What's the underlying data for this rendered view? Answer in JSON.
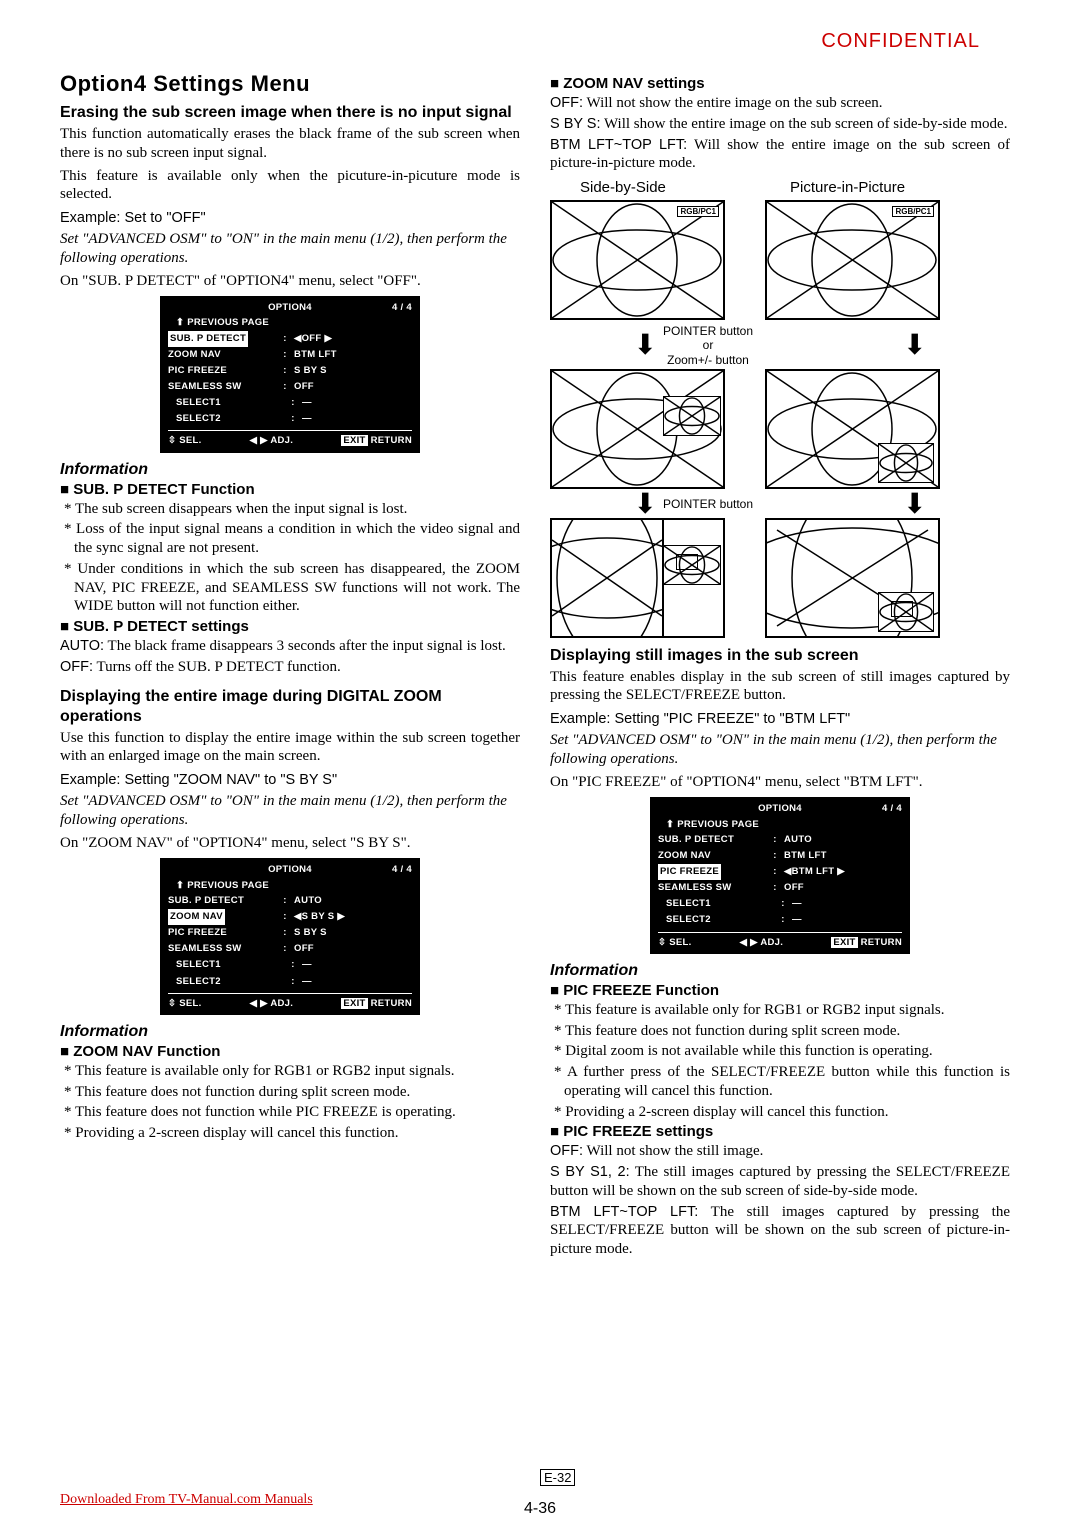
{
  "header": {
    "confidential": "CONFIDENTIAL"
  },
  "left": {
    "main_title": "Option4 Settings Menu",
    "sect1_title": "Erasing the sub screen image when there is no input signal",
    "sect1_p1": "This function automatically erases the black frame of the sub screen when there is no sub screen input signal.",
    "sect1_p2": "This feature is available only when the picuture-in-picuture mode is selected.",
    "sect1_example": "Example: Set to \"OFF\"",
    "sect1_ital": "Set \"ADVANCED OSM\" to \"ON\" in the main menu (1/2), then perform the following operations.",
    "sect1_p3": "On \"SUB. P DETECT\" of \"OPTION4\" menu, select \"OFF\".",
    "info1_title": "Information",
    "info1_h1": "SUB. P DETECT Function",
    "info1_b1": "* The sub screen disappears when the input signal is lost.",
    "info1_b2": "* Loss of the input signal means a condition in which the video signal and the sync signal are not present.",
    "info1_b3": "* Under conditions in which the sub screen has disappeared, the ZOOM NAV, PIC FREEZE, and SEAMLESS SW functions will not work. The WIDE button will not function either.",
    "info1_h2": "SUB. P DETECT settings",
    "info1_set1_label": "AUTO:",
    "info1_set1_body": " The black frame disappears 3 seconds after the input signal is lost.",
    "info1_set2_label": "OFF:",
    "info1_set2_body": " Turns off the SUB. P DETECT function.",
    "sect2_title": "Displaying the entire image during DIGITAL ZOOM operations",
    "sect2_p1": "Use this function to display the entire image within the sub screen together with an enlarged image on the main screen.",
    "sect2_example": "Example: Setting \"ZOOM NAV\" to \"S BY S\"",
    "sect2_ital": "Set \"ADVANCED OSM\" to \"ON\" in the main menu (1/2), then perform the following operations.",
    "sect2_p2": "On \"ZOOM NAV\" of \"OPTION4\" menu, select \"S BY S\".",
    "info2_title": "Information",
    "info2_h1": "ZOOM NAV Function",
    "info2_b1": "* This feature is available only for RGB1 or RGB2 input signals.",
    "info2_b2": "* This feature does not function during split screen mode.",
    "info2_b3": "* This feature does not function while PIC FREEZE is operating.",
    "info2_b4": "* Providing a 2-screen display will cancel this function."
  },
  "right": {
    "zoomnav_h": "ZOOM NAV settings",
    "zn_off_label": "OFF:",
    "zn_off_body": " Will not show the entire image on the sub screen.",
    "zn_sbs_label": "S BY S:",
    "zn_sbs_body": " Will show the entire image on the sub screen of side-by-side mode.",
    "zn_btm_label": "BTM LFT~TOP LFT:",
    "zn_btm_body": " Will show the entire image on the sub screen of picture-in-picture mode.",
    "diag_sbs": "Side-by-Side",
    "diag_pip": "Picture-in-Picture",
    "diag_tag": "RGB/PC1",
    "arrow1_a": "POINTER button",
    "arrow1_b": "or",
    "arrow1_c": "Zoom+/- button",
    "arrow2": "POINTER button",
    "sect3_title": "Displaying still images in the sub screen",
    "sect3_p1": "This feature enables display in the sub screen of still images captured by pressing the SELECT/FREEZE button.",
    "sect3_example": "Example: Setting \"PIC FREEZE\" to \"BTM LFT\"",
    "sect3_ital": "Set \"ADVANCED OSM\" to \"ON\" in the main menu (1/2), then perform the following operations.",
    "sect3_p2": "On \"PIC FREEZE\" of \"OPTION4\" menu, select \"BTM LFT\".",
    "info3_title": "Information",
    "info3_h1": "PIC FREEZE Function",
    "info3_b1": "* This feature is available only for RGB1 or RGB2 input signals.",
    "info3_b2": "* This feature does not function during split screen mode.",
    "info3_b3": "* Digital zoom is not available while this function is operating.",
    "info3_b4": "* A further press of the SELECT/FREEZE button while this function is operating will cancel this function.",
    "info3_b5": "* Providing a 2-screen display will cancel this function.",
    "info3_h2": "PIC FREEZE settings",
    "pf_off_label": "OFF:",
    "pf_off_body": " Will not show the still image.",
    "pf_sbs_label": "S BY S1, 2:",
    "pf_sbs_body": " The still images captured by pressing the SELECT/FREEZE button will be shown on the sub screen of side-by-side mode.",
    "pf_btm_label": "BTM LFT~TOP LFT:",
    "pf_btm_body": " The still images captured by pressing the SELECT/FREEZE button will be shown on the sub screen of picture-in-picture mode."
  },
  "osd": {
    "title": "OPTION4",
    "page": "4 / 4",
    "prev": "⬆ PREVIOUS PAGE",
    "items": {
      "sub_p": "SUB. P DETECT",
      "zoom": "ZOOM NAV",
      "pic": "PIC FREEZE",
      "seam": "SEAMLESS SW",
      "sel1": "SELECT1",
      "sel2": "SELECT2"
    },
    "colon": ":",
    "set1": {
      "sub_p": "◀OFF ▶",
      "zoom": "BTM LFT",
      "pic": "S BY S",
      "seam": "OFF",
      "sel1": "—",
      "sel2": "—"
    },
    "set2": {
      "sub_p": "AUTO",
      "zoom": "◀S BY S ▶",
      "pic": "S BY S",
      "seam": "OFF",
      "sel1": "—",
      "sel2": "—"
    },
    "set3": {
      "sub_p": "AUTO",
      "zoom": "BTM LFT",
      "pic": "◀BTM LFT ▶",
      "seam": "OFF",
      "sel1": "—",
      "sel2": "—"
    },
    "footer": {
      "sel": "⇳ SEL.",
      "adj": "◀ ▶ ADJ.",
      "exit": "EXIT",
      "ret": "RETURN"
    }
  },
  "footer": {
    "download": "Downloaded From TV-Manual.com Manuals",
    "page_e": "E-32",
    "page_436": "4-36"
  }
}
